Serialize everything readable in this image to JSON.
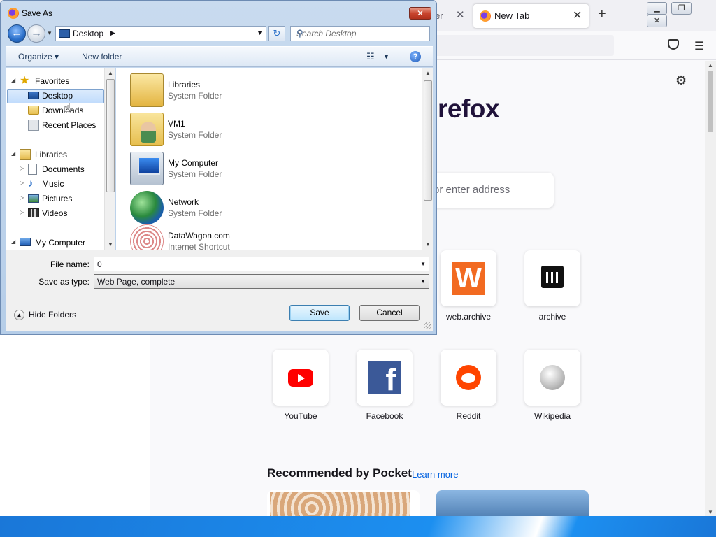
{
  "firefox": {
    "prev_tab_title": "er",
    "active_tab_title": "New Tab",
    "tab_close_glyph": "✕",
    "new_tab_glyph": "+",
    "window_buttons": [
      "▁",
      "❐",
      "✕"
    ],
    "logo_text": "refox",
    "search_placeholder": "or enter address",
    "top_sites": [
      {
        "label": "web.archive",
        "icon": "web-archive-icon"
      },
      {
        "label": "archive",
        "icon": "archive-icon"
      },
      {
        "label": "YouTube",
        "icon": "youtube-icon"
      },
      {
        "label": "Facebook",
        "icon": "facebook-icon"
      },
      {
        "label": "Reddit",
        "icon": "reddit-icon"
      },
      {
        "label": "Wikipedia",
        "icon": "wikipedia-icon"
      }
    ],
    "pocket_heading": "Recommended by Pocket",
    "pocket_learn_more": "Learn more"
  },
  "dialog": {
    "title": "Save As",
    "close_glyph": "✕",
    "address_location": "Desktop",
    "search_placeholder": "Search Desktop",
    "toolbar": {
      "organize": "Organize ▾",
      "new_folder": "New folder",
      "views_glyph": "☷",
      "help_glyph": "?"
    },
    "nav_pane": {
      "favorites_label": "Favorites",
      "favorites": [
        "Desktop",
        "Downloads",
        "Recent Places"
      ],
      "selected": "Desktop",
      "libraries_label": "Libraries",
      "libraries": [
        "Documents",
        "Music",
        "Pictures",
        "Videos"
      ],
      "computer_label": "My Computer"
    },
    "files": [
      {
        "name": "Libraries",
        "type": "System Folder",
        "icon": "libraries-folder-icon"
      },
      {
        "name": "VM1",
        "type": "System Folder",
        "icon": "user-folder-icon"
      },
      {
        "name": "My Computer",
        "type": "System Folder",
        "icon": "computer-icon"
      },
      {
        "name": "Network",
        "type": "System Folder",
        "icon": "network-icon"
      },
      {
        "name": "DataWagon.com",
        "type": "Internet Shortcut",
        "icon": "internet-shortcut-icon"
      }
    ],
    "form": {
      "file_name_label": "File name:",
      "file_name_value": "0",
      "save_type_label": "Save as type:",
      "save_type_value": "Web Page, complete"
    },
    "hide_folders": "Hide Folders",
    "save_button": "Save",
    "cancel_button": "Cancel"
  },
  "colors": {
    "dialog_frame": "#b5cde8",
    "selection": "#c1dcfc",
    "firefox_accent": "#0061e0",
    "taskbar": "#1c8ff0"
  }
}
